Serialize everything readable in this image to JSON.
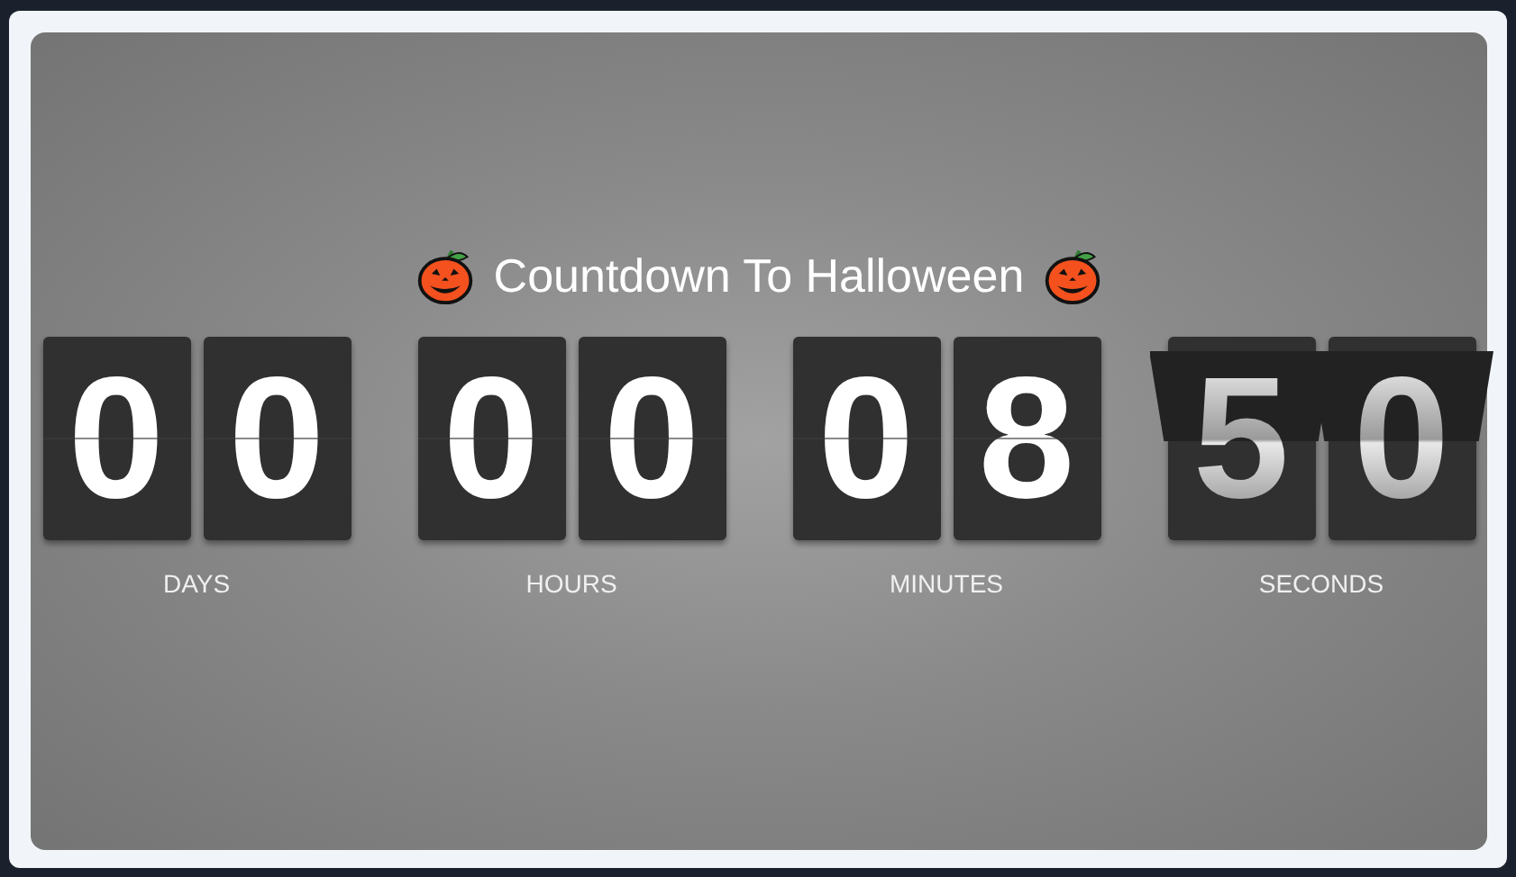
{
  "title": "Countdown To Halloween",
  "units": [
    {
      "digits": [
        "0",
        "0"
      ],
      "label": "DAYS",
      "flipping": false
    },
    {
      "digits": [
        "0",
        "0"
      ],
      "label": "HOURS",
      "flipping": false
    },
    {
      "digits": [
        "0",
        "8"
      ],
      "label": "MINUTES",
      "flipping": false
    },
    {
      "digits": [
        "5",
        "0"
      ],
      "label": "SECONDS",
      "flipping": true
    }
  ]
}
